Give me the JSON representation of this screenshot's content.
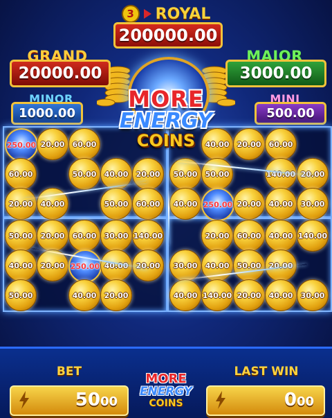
{
  "jackpots": {
    "royal": {
      "number": "3",
      "label": "ROYAL",
      "value": "200000.00"
    },
    "grand": {
      "label": "GRAND",
      "value": "20000.00"
    },
    "major": {
      "label": "MAJOR",
      "value": "3000.00"
    },
    "minor": {
      "label": "MINOR",
      "value": "1000.00"
    },
    "mini": {
      "label": "MINI",
      "value": "500.00"
    }
  },
  "logo": {
    "line1": "MORE",
    "line2": "ENERGY",
    "line3": "COINS"
  },
  "grid": {
    "top_left": [
      [
        "250.00",
        "20.00",
        "60.00",
        "",
        ""
      ],
      [
        "60.00",
        "",
        "50.00",
        "40.00",
        "20.00"
      ],
      [
        "20.00",
        "40.00",
        "",
        "50.00",
        "60.00"
      ]
    ],
    "top_right": [
      [
        "",
        "40.00",
        "20.00",
        "60.00",
        ""
      ],
      [
        "50.00",
        "50.00",
        "",
        "140.00",
        "20.00"
      ],
      [
        "40.00",
        "250.00",
        "20.00",
        "40.00",
        "30.00"
      ]
    ],
    "bottom_left": [
      [
        "50.00",
        "20.00",
        "60.00",
        "30.00",
        "140.00"
      ],
      [
        "40.00",
        "20.00",
        "250.00",
        "40.00",
        "20.00"
      ],
      [
        "50.00",
        "",
        "40.00",
        "20.00",
        ""
      ]
    ],
    "bottom_right": [
      [
        "",
        "20.00",
        "60.00",
        "40.00",
        "140.00"
      ],
      [
        "30.00",
        "40.00",
        "50.00",
        "20.00",
        ""
      ],
      [
        "40.00",
        "140.00",
        "20.00",
        "40.00",
        "30.00"
      ]
    ],
    "special_values": [
      "250.00"
    ]
  },
  "bet": {
    "label": "BET",
    "value_main": "50",
    "value_cents": "00"
  },
  "last_win": {
    "label": "LAST WIN",
    "value_main": "0",
    "value_cents": "00"
  }
}
